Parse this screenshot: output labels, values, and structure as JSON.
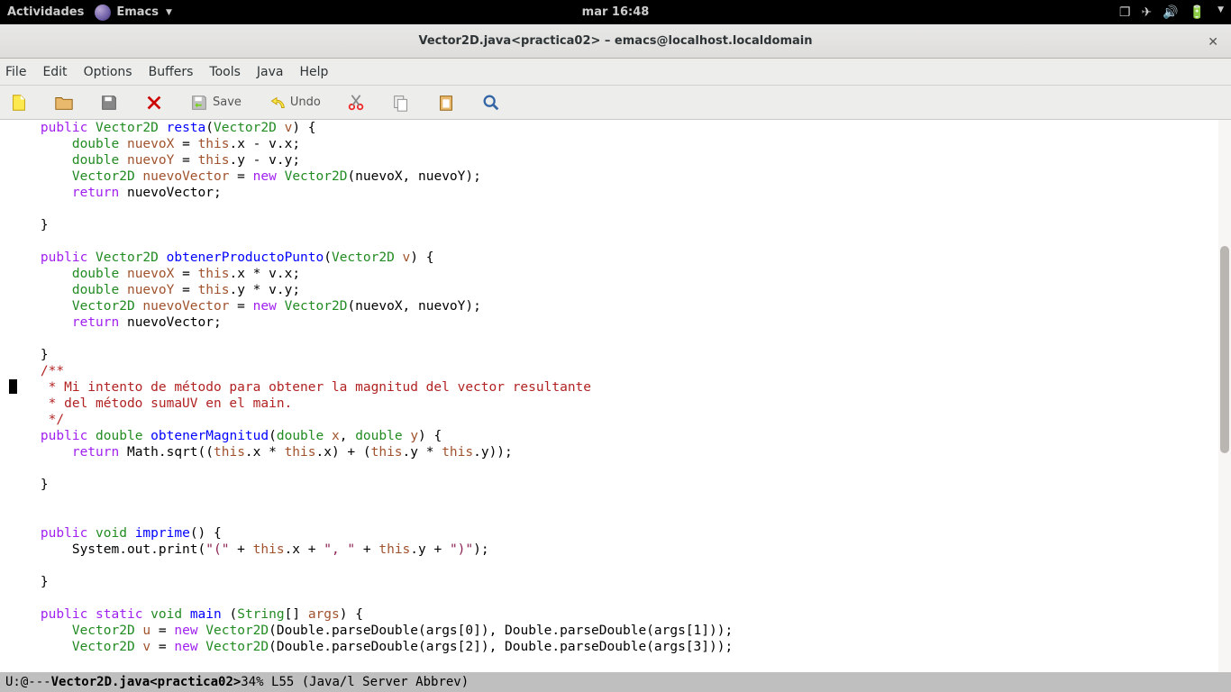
{
  "gnome": {
    "activities": "Actividades",
    "app": "Emacs",
    "clock": "mar 16:48"
  },
  "window": {
    "title": "Vector2D.java<practica02> – emacs@localhost.localdomain"
  },
  "menubar": [
    "File",
    "Edit",
    "Options",
    "Buffers",
    "Tools",
    "Java",
    "Help"
  ],
  "toolbar": {
    "save": "Save",
    "undo": "Undo"
  },
  "code": {
    "l1_a": "public",
    "l1_b": "Vector2D",
    "l1_c": "resta",
    "l1_d": "Vector2D",
    "l1_e": "v",
    "l2_a": "double",
    "l2_b": "nuevoX",
    "l2_c": "this",
    "l3_a": "double",
    "l3_b": "nuevoY",
    "l3_c": "this",
    "l4_a": "Vector2D",
    "l4_b": "nuevoVector",
    "l4_c": "new",
    "l4_d": "Vector2D",
    "l5_a": "return",
    "l8_a": "public",
    "l8_b": "Vector2D",
    "l8_c": "obtenerProductoPunto",
    "l8_d": "Vector2D",
    "l8_e": "v",
    "l9_a": "double",
    "l9_b": "nuevoX",
    "l9_c": "this",
    "l10_a": "double",
    "l10_b": "nuevoY",
    "l10_c": "this",
    "l11_a": "Vector2D",
    "l11_b": "nuevoVector",
    "l11_c": "new",
    "l11_d": "Vector2D",
    "l12_a": "return",
    "c1": "/**",
    "c2": " * Mi intento de método para obtener la magnitud del vector resultante",
    "c3": " * del método sumaUV en el main.",
    "c4": " */",
    "l16_a": "public",
    "l16_b": "double",
    "l16_c": "obtenerMagnitud",
    "l16_d": "double",
    "l16_e": "x",
    "l16_f": "double",
    "l16_g": "y",
    "l17_a": "return",
    "l17_b": "this",
    "l17_c": "this",
    "l17_d": "this",
    "l17_e": "this",
    "l20_a": "public",
    "l20_b": "void",
    "l20_c": "imprime",
    "l21_a": "this",
    "l21_b": "this",
    "l21_s1": "\"(\"",
    "l21_s2": "\", \"",
    "l21_s3": "\")\"",
    "l24_a": "public",
    "l24_b": "static",
    "l24_c": "void",
    "l24_d": "main",
    "l24_e": "String",
    "l24_f": "args",
    "l25_a": "Vector2D",
    "l25_b": "u",
    "l25_c": "new",
    "l25_d": "Vector2D",
    "l26_a": "Vector2D",
    "l26_b": "v",
    "l26_c": "new",
    "l26_d": "Vector2D"
  },
  "modeline": {
    "prefix": "U:@---  ",
    "buffer": "Vector2D.java<practica02>",
    "pos": "   34% L55    (Java/l Server Abbrev)"
  }
}
